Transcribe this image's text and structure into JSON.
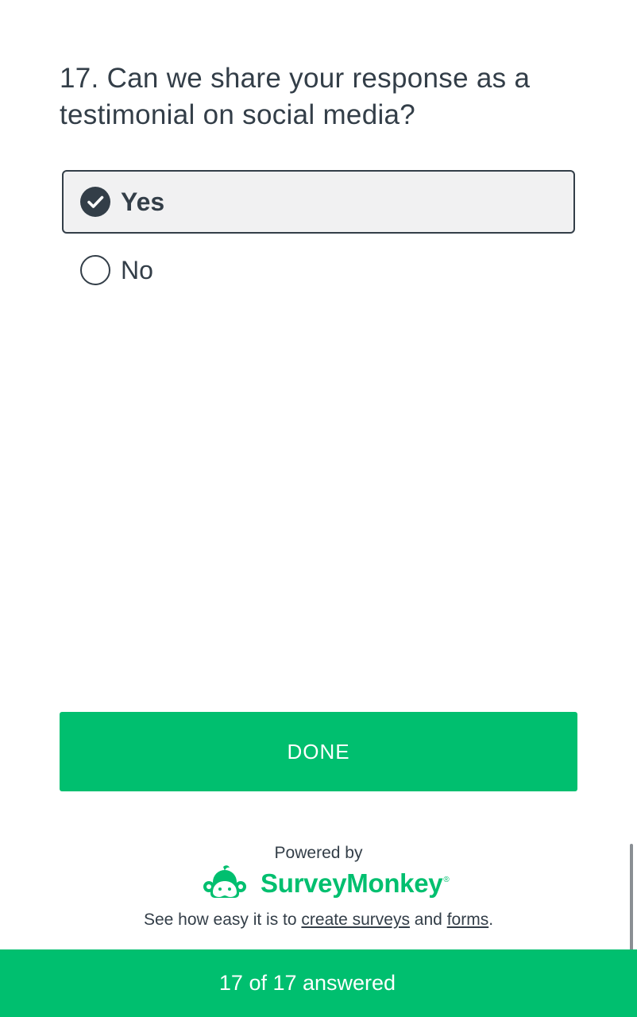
{
  "question": {
    "text": "17. Can we share your response as a testimonial on social media?"
  },
  "options": [
    {
      "label": "Yes",
      "selected": true
    },
    {
      "label": "No",
      "selected": false
    }
  ],
  "done_button": {
    "label": "DONE"
  },
  "powered_by": {
    "label": "Powered by",
    "brand_name": "SurveyMonkey",
    "brand_mark": "®",
    "brand_icon": "monkey-logo-icon"
  },
  "promo": {
    "prefix": "See how easy it is to ",
    "link1": "create surveys",
    "middle": " and ",
    "link2": "forms",
    "suffix": "."
  },
  "progress": {
    "text": "17 of 17 answered",
    "answered": 17,
    "total": 17
  },
  "colors": {
    "accent": "#00bf6f",
    "text": "#333e48",
    "selected_bg": "#f1f1f2"
  }
}
